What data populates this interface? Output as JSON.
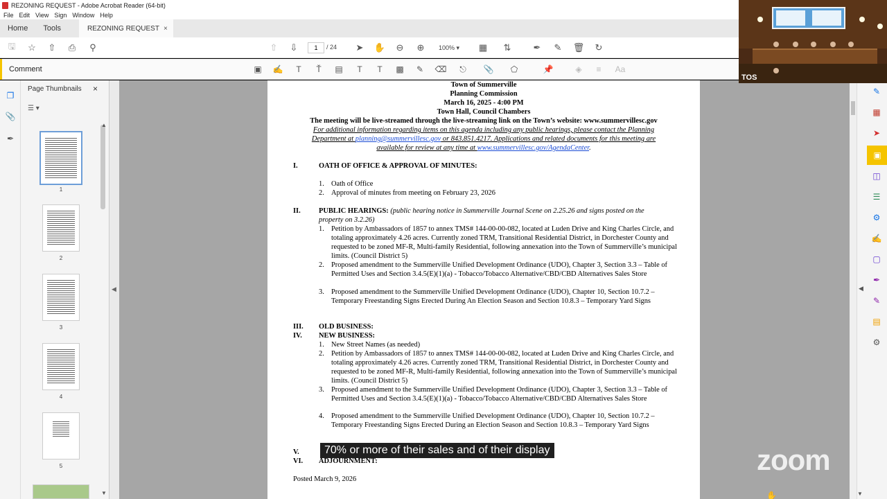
{
  "window": {
    "title": "REZONING REQUEST - Adobe Acrobat Reader (64-bit)"
  },
  "menu": [
    "File",
    "Edit",
    "View",
    "Sign",
    "Window",
    "Help"
  ],
  "tabs": {
    "home": "Home",
    "tools": "Tools",
    "doc": "REZONING REQUEST",
    "close": "×"
  },
  "toolbar": {
    "page_current": "1",
    "page_total": "/ 24",
    "zoom": "100%"
  },
  "comment_bar": {
    "label": "Comment",
    "clear_label": "Aa"
  },
  "thumbnails": {
    "title": "Page Thumbnails",
    "close": "×",
    "pages": [
      "1",
      "2",
      "3",
      "4",
      "5"
    ]
  },
  "document": {
    "header": [
      "Town of Summerville",
      "Planning Commission",
      "March 16, 2025 - 4:00 PM",
      "Town Hall, Council Chambers"
    ],
    "livestream": "The meeting will be live-streamed through the live-streaming link on the Town’s website: www.summervillesc.gov",
    "info_1": "For additional information regarding items on this agenda including any public hearings, please contact the Planning",
    "info_2a": "Department at ",
    "info_email": "planning@summervillesc.gov",
    "info_2b": " or 843.851.4217.  Applications and related documents for this meeting are",
    "info_3a": "available for review at any time at ",
    "info_link": "www.summervillesc.gov/AgendaCenter",
    "info_3b": ".",
    "s1_num": "I.",
    "s1_title": "OATH OF OFFICE & APPROVAL OF MINUTES:",
    "s1_items": [
      "Oath of Office",
      "Approval of minutes from meeting on February 23, 2026"
    ],
    "s2_num": "II.",
    "s2_title": "PUBLIC HEARINGS:",
    "s2_note_1": " (public hearing notice in Summerville Journal Scene on 2.25.26 and signs posted on the",
    "s2_note_2": "property on 3.2.26)",
    "s2_items": [
      "Petition by Ambassadors of 1857 to annex TMS# 144-00-00-082, located at Luden Drive and King Charles Circle, and totaling approximately 4.26 acres. Currently zoned TRM, Transitional Residential District, in Dorchester County and requested to be zoned MF-R, Multi-family Residential, following annexation into the Town of Summerville’s municipal limits. (Council District 5)",
      "Proposed amendment to the Summerville Unified Development Ordinance (UDO), Chapter 3, Section 3.3 – Table of Permitted Uses and Section 3.4.5(E)(1)(a) - Tobacco/Tobacco Alternative/CBD/CBD Alternatives Sales Store",
      "Proposed amendment to the Summerville Unified Development Ordinance (UDO), Chapter 10, Section 10.7.2 – Temporary Freestanding Signs Erected During An Election Season and Section 10.8.3 – Temporary Yard Signs"
    ],
    "s3_num": "III.",
    "s3_title": "OLD BUSINESS:",
    "s4_num": "IV.",
    "s4_title": "NEW BUSINESS:",
    "s4_items": [
      "New Street Names (as needed)",
      "Petition by Ambassadors of 1857 to annex TMS# 144-00-00-082, located at Luden Drive and King Charles Circle, and totaling approximately 4.26 acres. Currently zoned TRM, Transitional Residential District, in Dorchester County and requested to be zoned MF-R, Multi-family Residential, following annexation into the Town of Summerville’s municipal limits. (Council District 5)",
      "Proposed amendment to the Summerville Unified Development Ordinance (UDO), Chapter 3, Section 3.3 – Table of Permitted Uses and Section 3.4.5(E)(1)(a) - Tobacco/Tobacco Alternative/CBD/CBD Alternatives Sales Store",
      "Proposed amendment to the Summerville Unified Development Ordinance (UDO), Chapter 10, Section 10.7.2 – Temporary Freestanding Signs Erected During an Election Season and Section 10.8.3 – Temporary Yard Signs"
    ],
    "s5_num": "V.",
    "s6_num": "VI.",
    "s6_title": "ADJOURNMENT:",
    "posted": "Posted March 9, 2026"
  },
  "video": {
    "tag": "TOS"
  },
  "caption": "70% or more of their sales and of their display",
  "zoom_logo": "zoom"
}
